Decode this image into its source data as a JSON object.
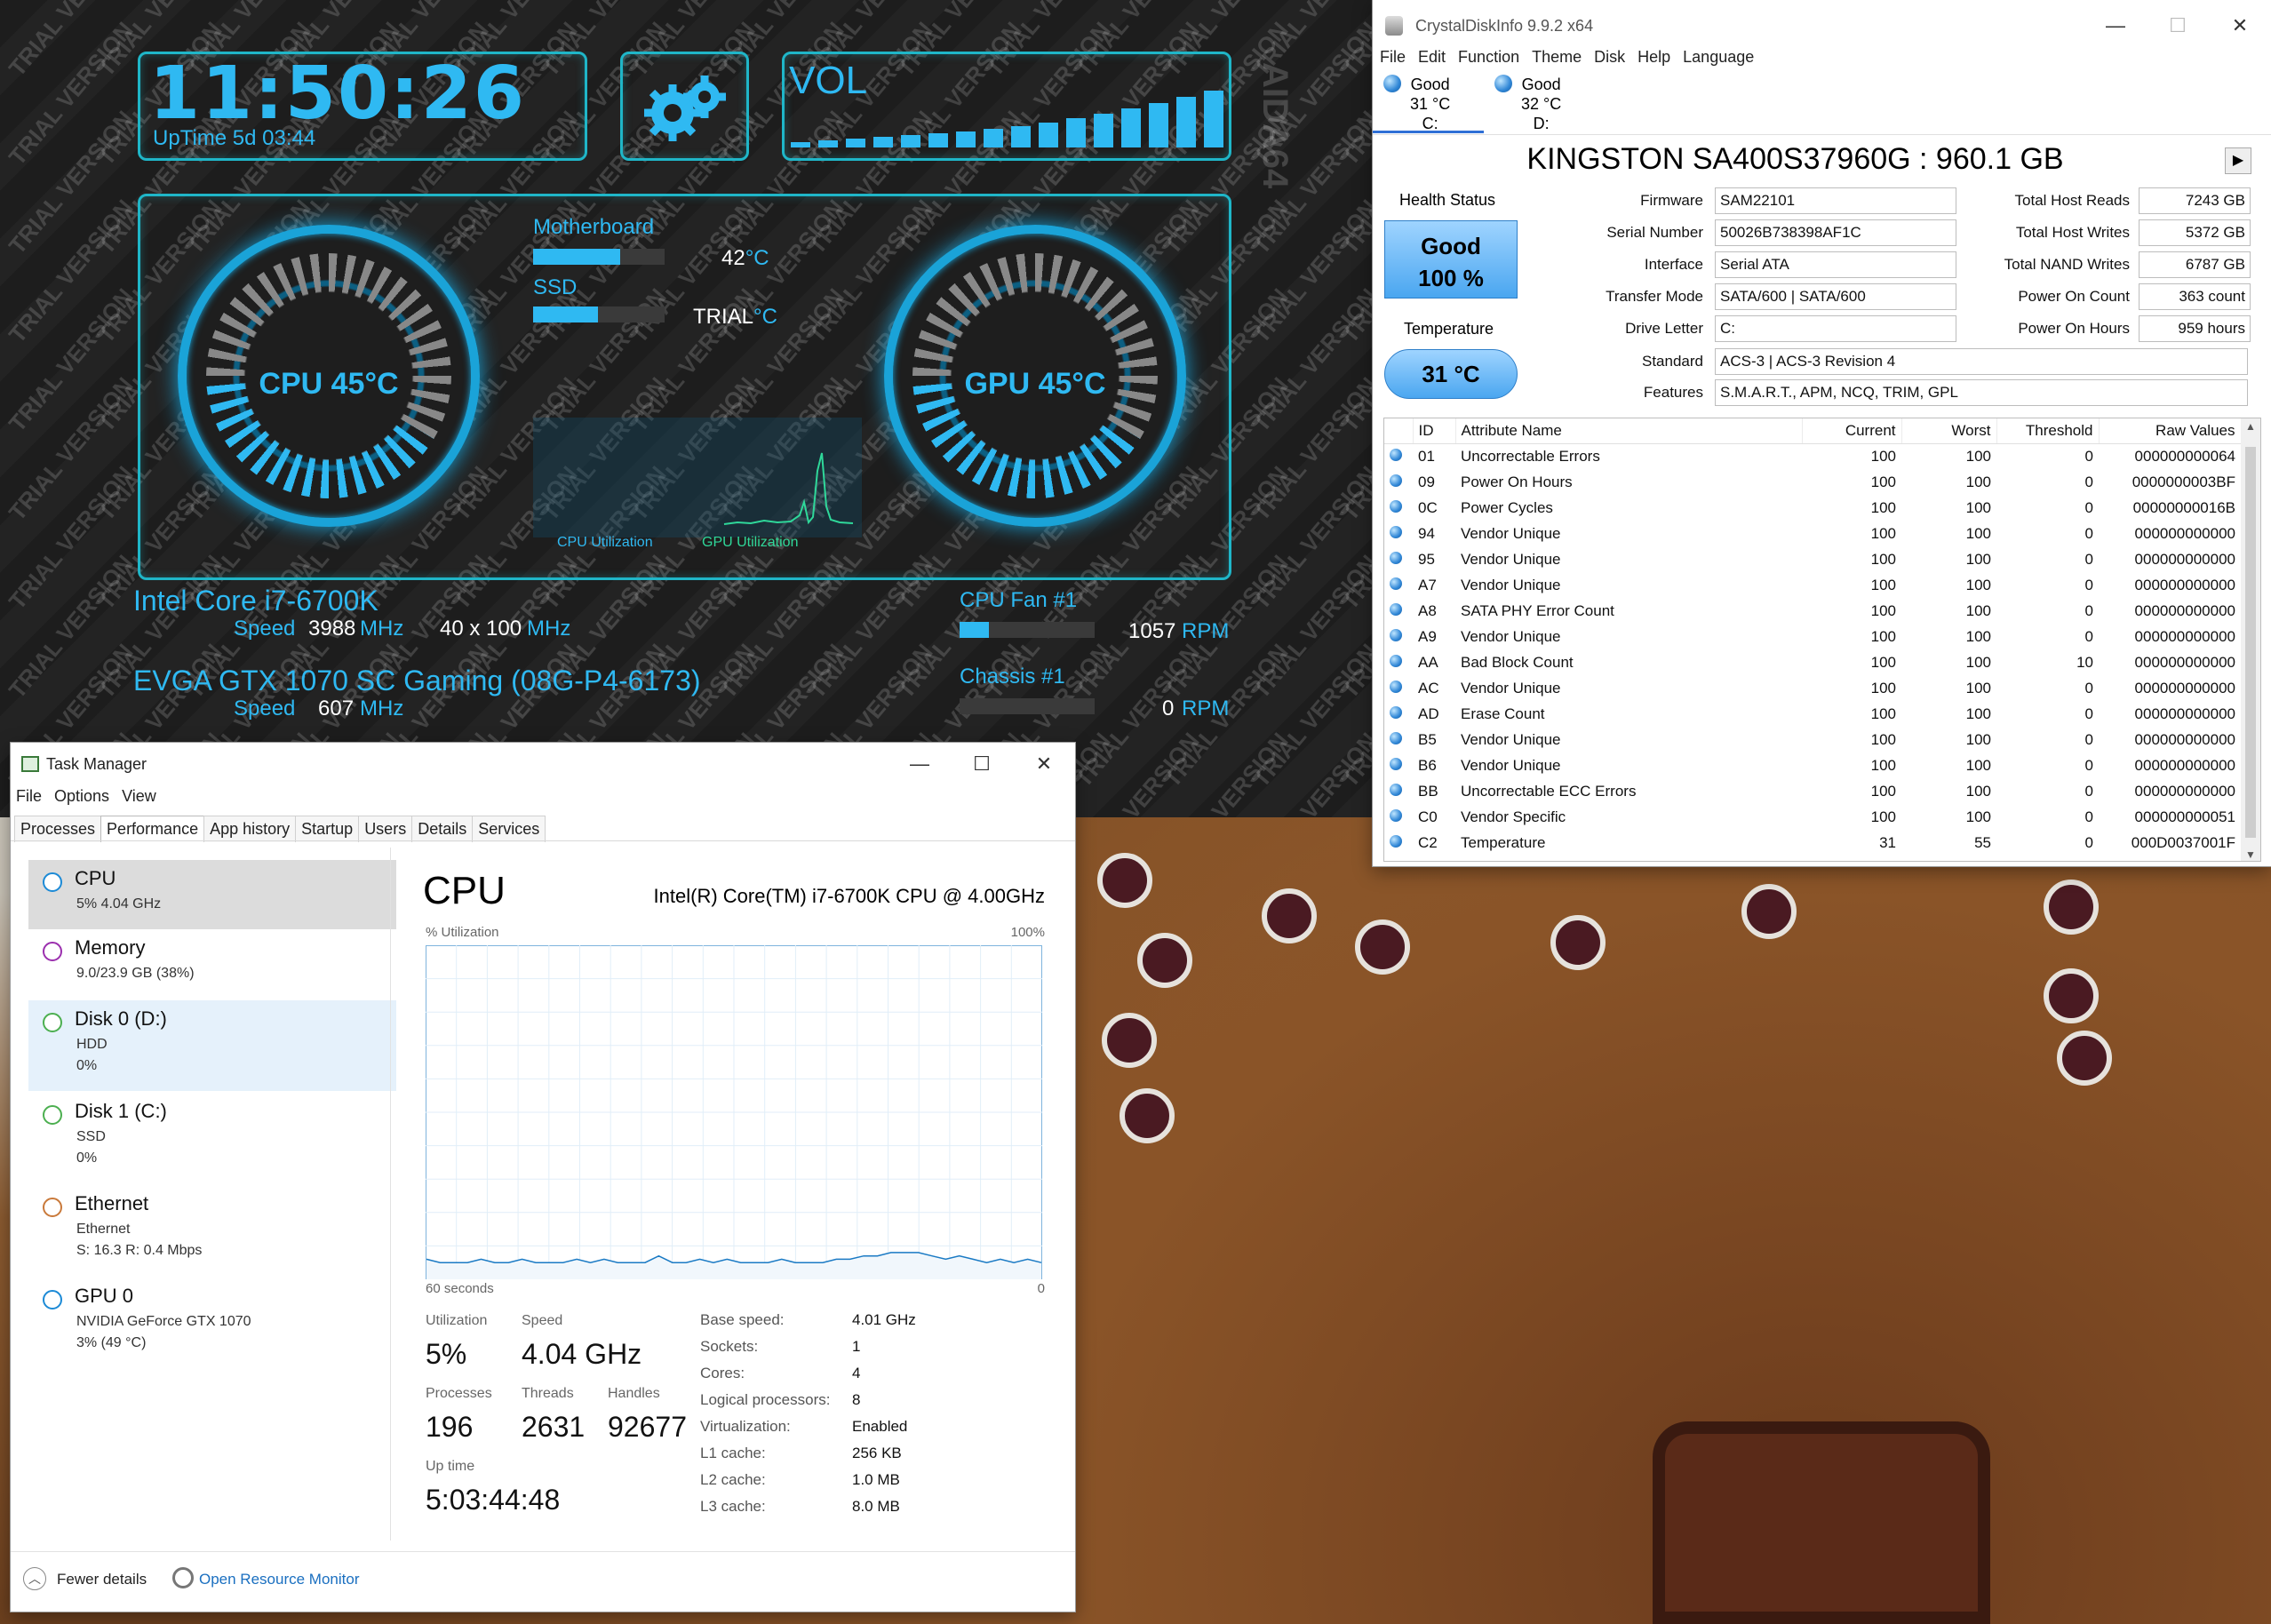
{
  "aida": {
    "clock": "11:50:26",
    "uptime": "UpTime 5d 03:44",
    "vol_label": "VOL",
    "cpu_gauge": "CPU 45°C",
    "gpu_gauge": "GPU 45°C",
    "motherboard_label": "Motherboard",
    "motherboard_value": "42",
    "ssd_label": "SSD",
    "ssd_value": "TRIAL",
    "temp_unit": "°C",
    "cpu_util_label": "CPU Utilization",
    "gpu_util_label": "GPU Utilization",
    "cpu_name": "Intel Core i7-6700K",
    "speed_label": "Speed",
    "cpu_speed": "3988",
    "mhz": "MHz",
    "multiplier": "40 x 100",
    "gpu_name": "EVGA GTX 1070 SC Gaming (08G-P4-6173)",
    "gpu_speed": "607",
    "fan1_label": "CPU Fan #1",
    "fan1_value": "1057",
    "chassis_label": "Chassis #1",
    "chassis_value": "0",
    "rpm": "RPM",
    "watermark": "TRIAL VERSION",
    "side_brand": "AIDA64",
    "cpu_gauge_fraction": 0.45,
    "gpu_gauge_fraction": 0.45
  },
  "taskmgr": {
    "title": "Task Manager",
    "menu": [
      "File",
      "Options",
      "View"
    ],
    "tabs": [
      "Processes",
      "Performance",
      "App history",
      "Startup",
      "Users",
      "Details",
      "Services"
    ],
    "active_tab": "Performance",
    "sidebar": [
      {
        "title": "CPU",
        "sub1": "5%  4.04 GHz",
        "sub2": "",
        "sub3": "",
        "color": "#1c8ad6"
      },
      {
        "title": "Memory",
        "sub1": "9.0/23.9 GB (38%)",
        "sub2": "",
        "sub3": "",
        "color": "#9b2fae"
      },
      {
        "title": "Disk 0 (D:)",
        "sub1": "HDD",
        "sub2": "0%",
        "sub3": "",
        "color": "#4caf50"
      },
      {
        "title": "Disk 1 (C:)",
        "sub1": "SSD",
        "sub2": "0%",
        "sub3": "",
        "color": "#4caf50"
      },
      {
        "title": "Ethernet",
        "sub1": "Ethernet",
        "sub2": "S: 16.3  R: 0.4 Mbps",
        "sub3": "",
        "color": "#c9793a"
      },
      {
        "title": "GPU 0",
        "sub1": "NVIDIA GeForce GTX 1070",
        "sub2": "3%  (49 °C)",
        "sub3": "",
        "color": "#1c8ad6"
      }
    ],
    "main_title": "CPU",
    "cpu_model": "Intel(R) Core(TM) i7-6700K CPU @ 4.00GHz",
    "util_axis_label": "% Utilization",
    "util_axis_max": "100%",
    "time_axis_left": "60 seconds",
    "time_axis_right": "0",
    "stats": {
      "utilization_label": "Utilization",
      "utilization": "5%",
      "speed_label": "Speed",
      "speed": "4.04 GHz",
      "processes_label": "Processes",
      "processes": "196",
      "threads_label": "Threads",
      "threads": "2631",
      "handles_label": "Handles",
      "handles": "92677",
      "uptime_label": "Up time",
      "uptime": "5:03:44:48"
    },
    "specs": [
      {
        "k": "Base speed:",
        "v": "4.01 GHz"
      },
      {
        "k": "Sockets:",
        "v": "1"
      },
      {
        "k": "Cores:",
        "v": "4"
      },
      {
        "k": "Logical processors:",
        "v": "8"
      },
      {
        "k": "Virtualization:",
        "v": "Enabled"
      },
      {
        "k": "L1 cache:",
        "v": "256 KB"
      },
      {
        "k": "L2 cache:",
        "v": "1.0 MB"
      },
      {
        "k": "L3 cache:",
        "v": "8.0 MB"
      }
    ],
    "fewer_details": "Fewer details",
    "resource_monitor": "Open Resource Monitor",
    "cpu_history": [
      6,
      5,
      5,
      5,
      6,
      5,
      5,
      6,
      5,
      5,
      5,
      6,
      5,
      6,
      5,
      5,
      5,
      7,
      5,
      5,
      6,
      5,
      6,
      5,
      5,
      5,
      6,
      5,
      5,
      5,
      6,
      6,
      7,
      7,
      8,
      8,
      8,
      7,
      6,
      7,
      6,
      5,
      6,
      5,
      6,
      5
    ]
  },
  "cdi": {
    "title": "CrystalDiskInfo 9.9.2 x64",
    "menu": [
      "File",
      "Edit",
      "Function",
      "Theme",
      "Disk",
      "Help",
      "Language"
    ],
    "drives": [
      {
        "status": "Good",
        "temp": "31 °C",
        "letter": "C:"
      },
      {
        "status": "Good",
        "temp": "32 °C",
        "letter": "D:"
      }
    ],
    "model": "KINGSTON SA400S37960G : 960.1 GB",
    "health_label": "Health Status",
    "health_status": "Good",
    "health_pct": "100 %",
    "temp_label": "Temperature",
    "temp_value": "31 °C",
    "fields_left": [
      {
        "k": "Firmware",
        "v": "SAM22101"
      },
      {
        "k": "Serial Number",
        "v": "50026B738398AF1C"
      },
      {
        "k": "Interface",
        "v": "Serial ATA"
      },
      {
        "k": "Transfer Mode",
        "v": "SATA/600 | SATA/600"
      },
      {
        "k": "Drive Letter",
        "v": "C:"
      }
    ],
    "fields_right": [
      {
        "k": "Total Host Reads",
        "v": "7243 GB"
      },
      {
        "k": "Total Host Writes",
        "v": "5372 GB"
      },
      {
        "k": "Total NAND Writes",
        "v": "6787 GB"
      },
      {
        "k": "Power On Count",
        "v": "363 count"
      },
      {
        "k": "Power On Hours",
        "v": "959 hours"
      }
    ],
    "standard_label": "Standard",
    "standard": "ACS-3 | ACS-3 Revision 4",
    "features_label": "Features",
    "features": "S.M.A.R.T., APM, NCQ, TRIM, GPL",
    "smart_headers": [
      "ID",
      "Attribute Name",
      "Current",
      "Worst",
      "Threshold",
      "Raw Values"
    ],
    "smart_rows": [
      [
        "01",
        "Uncorrectable Errors",
        "100",
        "100",
        "0",
        "000000000064"
      ],
      [
        "09",
        "Power On Hours",
        "100",
        "100",
        "0",
        "0000000003BF"
      ],
      [
        "0C",
        "Power Cycles",
        "100",
        "100",
        "0",
        "00000000016B"
      ],
      [
        "94",
        "Vendor Unique",
        "100",
        "100",
        "0",
        "000000000000"
      ],
      [
        "95",
        "Vendor Unique",
        "100",
        "100",
        "0",
        "000000000000"
      ],
      [
        "A7",
        "Vendor Unique",
        "100",
        "100",
        "0",
        "000000000000"
      ],
      [
        "A8",
        "SATA PHY Error Count",
        "100",
        "100",
        "0",
        "000000000000"
      ],
      [
        "A9",
        "Vendor Unique",
        "100",
        "100",
        "0",
        "000000000000"
      ],
      [
        "AA",
        "Bad Block Count",
        "100",
        "100",
        "10",
        "000000000000"
      ],
      [
        "AC",
        "Vendor Unique",
        "100",
        "100",
        "0",
        "000000000000"
      ],
      [
        "AD",
        "Erase Count",
        "100",
        "100",
        "0",
        "000000000000"
      ],
      [
        "B5",
        "Vendor Unique",
        "100",
        "100",
        "0",
        "000000000000"
      ],
      [
        "B6",
        "Vendor Unique",
        "100",
        "100",
        "0",
        "000000000000"
      ],
      [
        "BB",
        "Uncorrectable ECC Errors",
        "100",
        "100",
        "0",
        "000000000000"
      ],
      [
        "C0",
        "Vendor Specific",
        "100",
        "100",
        "0",
        "000000000051"
      ],
      [
        "C2",
        "Temperature",
        "31",
        "55",
        "0",
        "000D0037001F"
      ]
    ]
  }
}
